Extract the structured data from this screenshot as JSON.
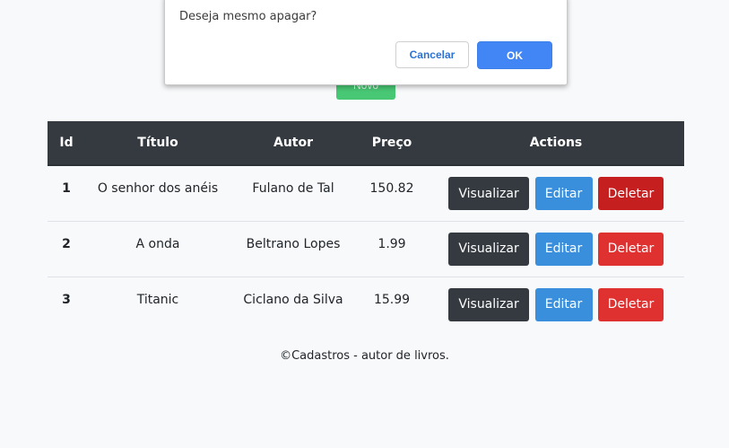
{
  "dialog": {
    "message": "Deseja mesmo apagar?",
    "cancel_label": "Cancelar",
    "ok_label": "OK"
  },
  "add_button": {
    "label": "Novo"
  },
  "table": {
    "headers": {
      "id": "Id",
      "titulo": "Título",
      "autor": "Autor",
      "preco": "Preço",
      "actions": "Actions"
    },
    "rows": [
      {
        "id": "1",
        "titulo": "O senhor dos anéis",
        "autor": "Fulano de Tal",
        "preco": "150.82"
      },
      {
        "id": "2",
        "titulo": "A onda",
        "autor": "Beltrano Lopes",
        "preco": "1.99"
      },
      {
        "id": "3",
        "titulo": "Titanic",
        "autor": "Ciclano da Silva",
        "preco": "15.99"
      }
    ],
    "actions": {
      "view_label": "Visualizar",
      "edit_label": "Editar",
      "delete_label": "Deletar"
    }
  },
  "footer": {
    "text": "©Cadastros - autor de livros."
  },
  "colors": {
    "header_bg": "#343a40",
    "view_btn": "#343a40",
    "edit_btn": "#3a8fdd",
    "delete_btn": "#e03131",
    "add_btn": "#48c774",
    "dialog_ok": "#4285f4"
  }
}
